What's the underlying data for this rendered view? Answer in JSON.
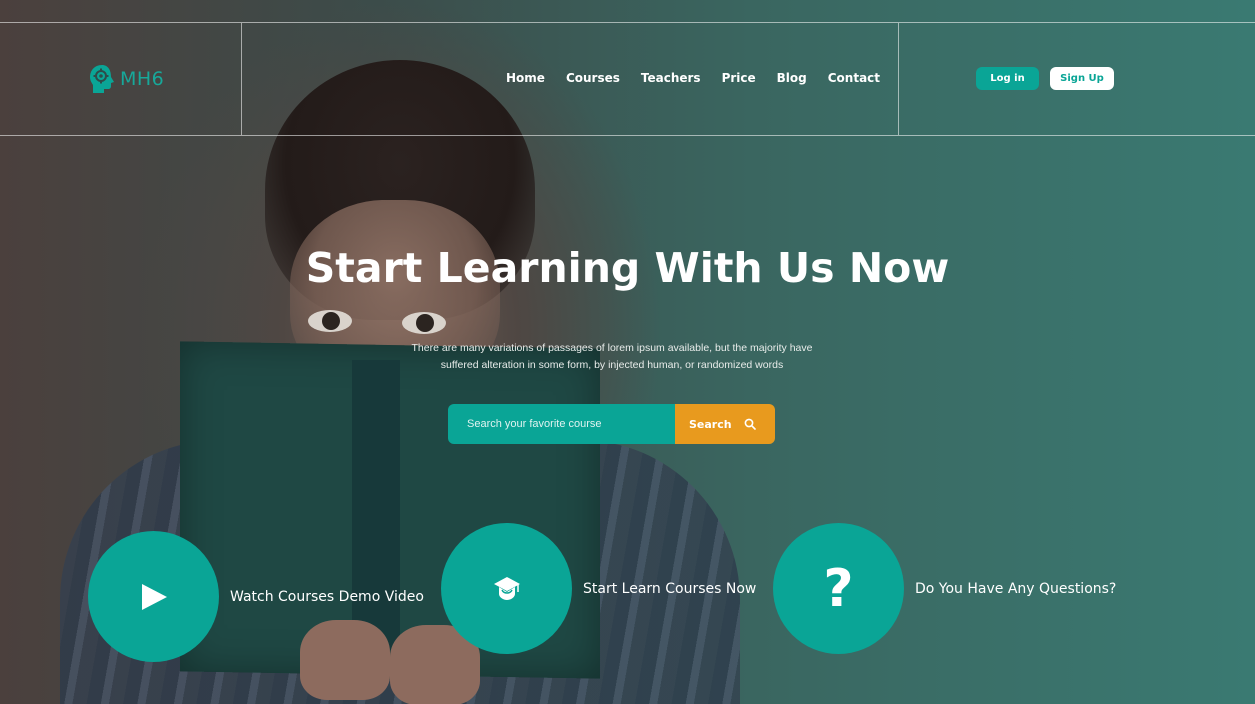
{
  "brand": {
    "logo_text": "MH6",
    "logo_icon": "head-gear-icon",
    "accent_color": "#0aa596"
  },
  "nav": {
    "items": [
      "Home",
      "Courses",
      "Teachers",
      "Price",
      "Blog",
      "Contact"
    ]
  },
  "auth": {
    "login_label": "Log in",
    "signup_label": "Sign Up"
  },
  "hero": {
    "title": "Start Learning With Us Now",
    "subtitle": "There are many variations of passages of lorem ipsum available, but the majority have suffered alteration in some form, by injected human, or randomized words"
  },
  "search": {
    "placeholder": "Search your favorite course",
    "button_label": "Search",
    "button_color": "#e89a1e",
    "icon": "search-icon"
  },
  "features": [
    {
      "label": "Watch Courses Demo Video",
      "icon": "play-icon"
    },
    {
      "label": "Start Learn Courses Now",
      "icon": "graduation-cap-icon"
    },
    {
      "label": "Do You Have Any Questions?",
      "icon": "question-mark-icon"
    }
  ]
}
